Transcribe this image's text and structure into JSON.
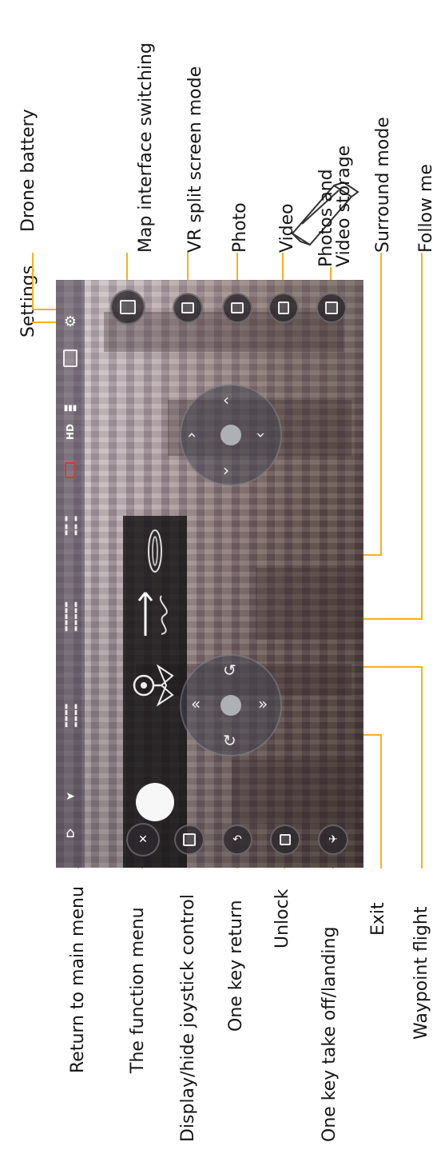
{
  "labels": {
    "return_main": "Return to main menu",
    "function_menu": "The function menu",
    "joystick": "Display/hide joystick control",
    "key_return": "One key return",
    "unlock": "Unlock",
    "takeoff": "One key take off/landing",
    "exit": "Exit",
    "waypoint": "Waypoint flight",
    "drone_battery": "Drone battery",
    "settings": "Settings",
    "map_switch": "Map interface switching",
    "vr": "VR split screen mode",
    "photo": "Photo",
    "video": "Video",
    "storage_1": "Photos and",
    "storage_2": "Video storage",
    "surround": "Surround mode",
    "follow": "Follow me"
  },
  "screen": {
    "hd_badge": "HD",
    "accent": "#f2b21c",
    "battery_color": "#d33b3b"
  },
  "icons": {
    "home": "home-icon",
    "settings": "gear-icon",
    "camera": "camera-icon",
    "map": "map-icon",
    "vr": "vr-glasses-icon",
    "photo": "camera-shutter-icon",
    "video": "video-camera-icon",
    "storage": "folder-icon",
    "lock": "lock-icon",
    "takeoff": "takeoff-icon",
    "return": "return-icon",
    "joystick": "joystick-icon",
    "function": "function-menu-icon",
    "waypoint": "waypoint-icon",
    "follow": "follow-me-icon",
    "surround": "surround-icon"
  }
}
